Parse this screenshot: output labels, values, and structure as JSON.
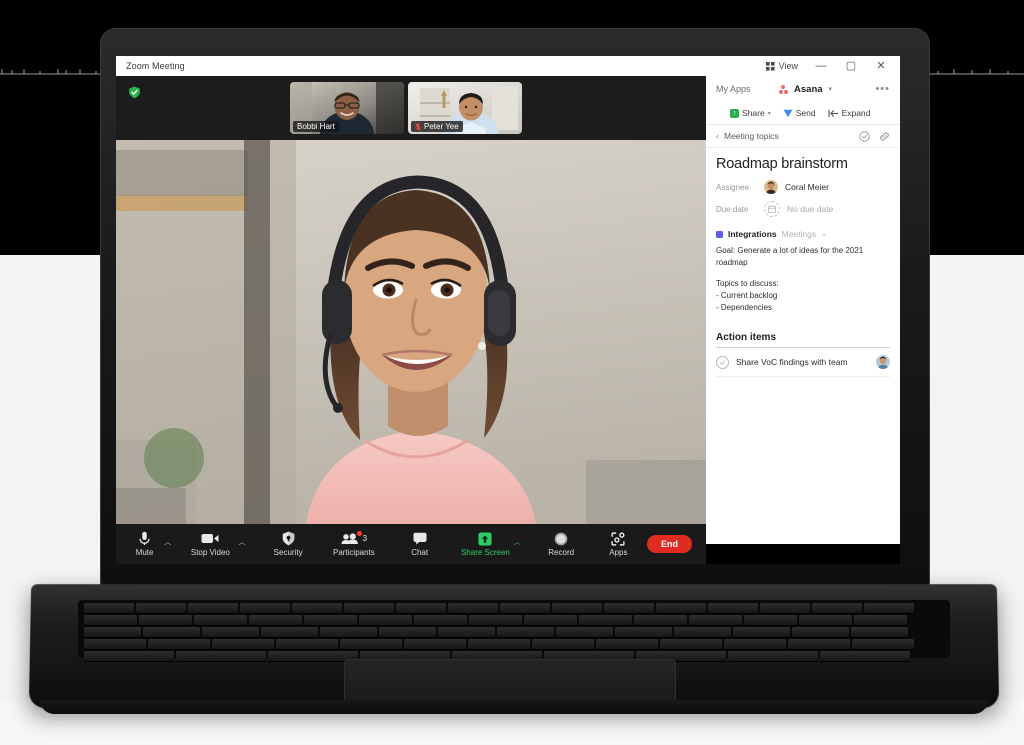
{
  "window": {
    "title": "Zoom Meeting",
    "view_label": "View",
    "minimize": "—",
    "maximize": "▢",
    "close": "✕"
  },
  "filmstrip": {
    "participants": [
      {
        "name": "Bobbi Hart",
        "muted": false
      },
      {
        "name": "Peter Yee",
        "muted": true
      }
    ]
  },
  "toolbar": {
    "mute": "Mute",
    "stop_video": "Stop Video",
    "security": "Security",
    "participants": "Participants",
    "participants_count": "3",
    "chat": "Chat",
    "share_screen": "Share Screen",
    "record": "Record",
    "apps": "Apps",
    "end": "End",
    "share_screen_color": "#2fcc62",
    "end_color": "#e02b20"
  },
  "sidebar": {
    "my_apps": "My Apps",
    "app_name": "Asana",
    "more": "•••",
    "actions": [
      {
        "label": "Share",
        "icon": "share-icon",
        "caret": true
      },
      {
        "label": "Send",
        "icon": "send-icon",
        "caret": false
      },
      {
        "label": "Expand",
        "icon": "expand-icon",
        "caret": false
      }
    ],
    "breadcrumb": "Meeting topics",
    "task": {
      "title": "Roadmap brainstorm",
      "assignee_label": "Assignee",
      "assignee_name": "Coral Meier",
      "due_date_label": "Due date",
      "due_date_value": "No due date"
    },
    "integrations": {
      "label": "Integrations",
      "sub": "Meetings",
      "accent": "#5f5af6"
    },
    "notes": {
      "goal": "Goal: Generate a lot of ideas for the 2021 roadmap",
      "topics_heading": "Topics to discuss:",
      "topics": [
        "- Current backlog",
        "- Dependencies"
      ]
    },
    "action_items": {
      "heading": "Action items",
      "items": [
        {
          "text": "Share VoC findings with team",
          "done": false
        }
      ]
    }
  }
}
